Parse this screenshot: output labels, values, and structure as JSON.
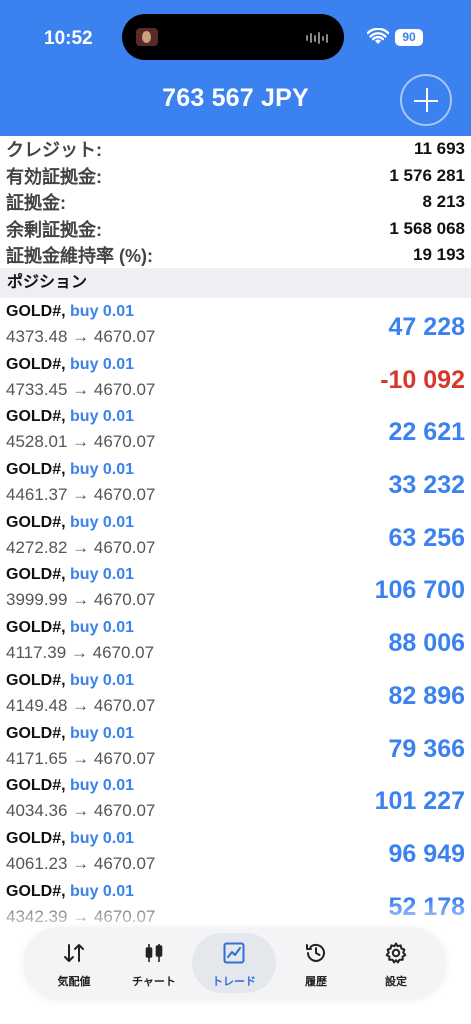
{
  "status_bar": {
    "time": "10:52",
    "battery": "90"
  },
  "header": {
    "balance": "763 567 JPY",
    "add_icon": "plus-icon"
  },
  "summary": [
    {
      "label": "クレジット:",
      "value": "11 693"
    },
    {
      "label": "有効証拠金:",
      "value": "1 576 281"
    },
    {
      "label": "証拠金:",
      "value": "8 213"
    },
    {
      "label": "余剰証拠金:",
      "value": "1 568 068"
    },
    {
      "label": "証拠金維持率 (%):",
      "value": "19 193"
    }
  ],
  "positions_title": "ポジション",
  "positions": [
    {
      "symbol": "GOLD#,",
      "side": "buy 0.01",
      "prices": "4373.48 → 4670.07",
      "profit": "47 228",
      "negative": false
    },
    {
      "symbol": "GOLD#,",
      "side": "buy 0.01",
      "prices": "4733.45 → 4670.07",
      "profit": "-10 092",
      "negative": true
    },
    {
      "symbol": "GOLD#,",
      "side": "buy 0.01",
      "prices": "4528.01 → 4670.07",
      "profit": "22 621",
      "negative": false
    },
    {
      "symbol": "GOLD#,",
      "side": "buy 0.01",
      "prices": "4461.37 → 4670.07",
      "profit": "33 232",
      "negative": false
    },
    {
      "symbol": "GOLD#,",
      "side": "buy 0.01",
      "prices": "4272.82 → 4670.07",
      "profit": "63 256",
      "negative": false
    },
    {
      "symbol": "GOLD#,",
      "side": "buy 0.01",
      "prices": "3999.99 → 4670.07",
      "profit": "106 700",
      "negative": false
    },
    {
      "symbol": "GOLD#,",
      "side": "buy 0.01",
      "prices": "4117.39 → 4670.07",
      "profit": "88 006",
      "negative": false
    },
    {
      "symbol": "GOLD#,",
      "side": "buy 0.01",
      "prices": "4149.48 → 4670.07",
      "profit": "82 896",
      "negative": false
    },
    {
      "symbol": "GOLD#,",
      "side": "buy 0.01",
      "prices": "4171.65 → 4670.07",
      "profit": "79 366",
      "negative": false
    },
    {
      "symbol": "GOLD#,",
      "side": "buy 0.01",
      "prices": "4034.36 → 4670.07",
      "profit": "101 227",
      "negative": false
    },
    {
      "symbol": "GOLD#,",
      "side": "buy 0.01",
      "prices": "4061.23 → 4670.07",
      "profit": "96 949",
      "negative": false
    },
    {
      "symbol": "GOLD#,",
      "side": "buy 0.01",
      "prices": "4342.39 → 4670.07",
      "profit": "52 178",
      "negative": false
    }
  ],
  "tabs": [
    {
      "label": "気配値",
      "icon": "quotes-arrows-icon",
      "active": false
    },
    {
      "label": "チャート",
      "icon": "candlestick-chart-icon",
      "active": false
    },
    {
      "label": "トレード",
      "icon": "trade-chart-icon",
      "active": true
    },
    {
      "label": "履歴",
      "icon": "history-clock-icon",
      "active": false
    },
    {
      "label": "設定",
      "icon": "settings-gear-icon",
      "active": false
    }
  ],
  "colors": {
    "accent": "#3B82F0",
    "negative": "#D8382B",
    "section_bg": "#EFEFF3"
  }
}
